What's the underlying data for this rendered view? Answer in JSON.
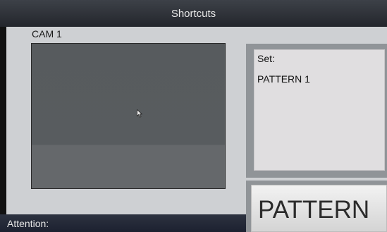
{
  "window": {
    "title": "Shortcuts"
  },
  "camera": {
    "label": "CAM 1"
  },
  "info": {
    "set_label": "Set:",
    "set_value": "PATTERN 1"
  },
  "action": {
    "pattern_label": "PATTERN"
  },
  "status": {
    "attention_label": "Attention:"
  },
  "icons": {
    "cursor": "mouse-pointer-icon"
  }
}
